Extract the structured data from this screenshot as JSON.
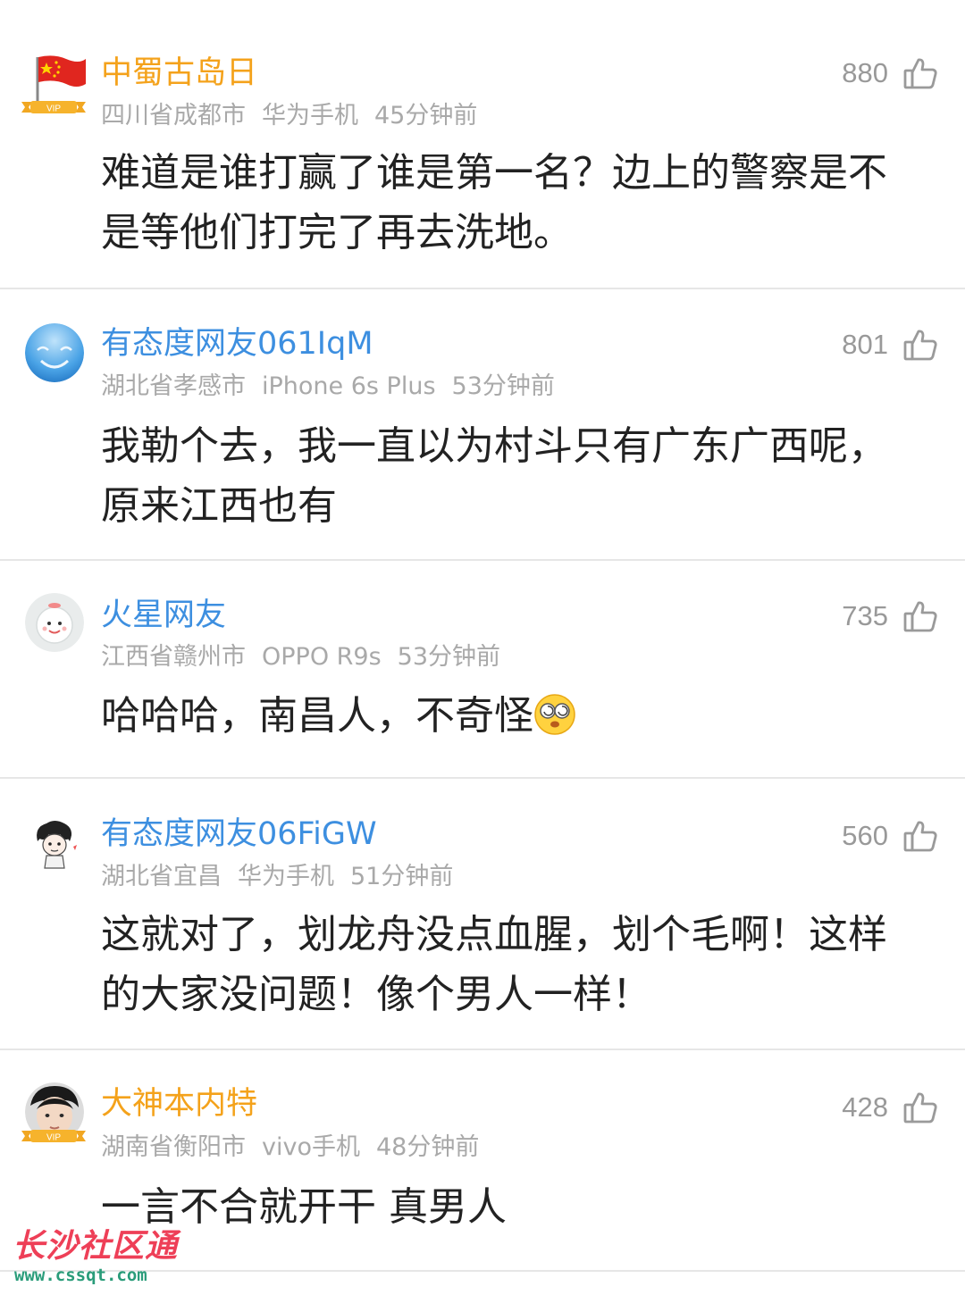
{
  "colors": {
    "username_orange": "#f4a21b",
    "username_blue": "#3d8fe0",
    "meta_gray": "#a9a9a9",
    "body_text": "#222222",
    "like_gray": "#999999",
    "watermark_red": "#ee3f57",
    "watermark_green": "#2a9c7a"
  },
  "comments": [
    {
      "avatar_icon": "china-flag-avatar-icon",
      "vip": true,
      "vip_label": "VIP",
      "username": "中蜀古岛日",
      "username_color": "orange",
      "location": "四川省成都市",
      "device": "华为手机",
      "time": "45分钟前",
      "text": "难道是谁打赢了谁是第一名？边上的警察是不是等他们打完了再去洗地。",
      "likes": "880"
    },
    {
      "avatar_icon": "sky-face-avatar-icon",
      "vip": false,
      "username": "有态度网友061IqM",
      "username_color": "blue",
      "location": "湖北省孝感市",
      "device": "iPhone 6s Plus",
      "time": "53分钟前",
      "text": "我勒个去，我一直以为村斗只有广东广西呢，原来江西也有",
      "likes": "801"
    },
    {
      "avatar_icon": "cartoon-ghost-avatar-icon",
      "vip": false,
      "username": "火星网友",
      "username_color": "blue",
      "location": "江西省赣州市",
      "device": "OPPO R9s",
      "time": "53分钟前",
      "text": "哈哈哈，南昌人，不奇怪",
      "emoji": "dizzy-eyes-emoji-icon",
      "likes": "735"
    },
    {
      "avatar_icon": "afro-doodle-avatar-icon",
      "vip": false,
      "username": "有态度网友06FiGW",
      "username_color": "blue",
      "location": "湖北省宜昌",
      "device": "华为手机",
      "time": "51分钟前",
      "text": "这就对了，划龙舟没点血腥，划个毛啊！这样的大家没问题！像个男人一样！",
      "likes": "560"
    },
    {
      "avatar_icon": "boy-photo-avatar-icon",
      "vip": true,
      "vip_label": "VIP",
      "username": "大神本内特",
      "username_color": "orange",
      "location": "湖南省衡阳市",
      "device": "vivo手机",
      "time": "48分钟前",
      "text": "一言不合就开干 真男人",
      "likes": "428"
    }
  ],
  "watermark": {
    "title": "长沙社区通",
    "url": "www.cssqt.com"
  }
}
